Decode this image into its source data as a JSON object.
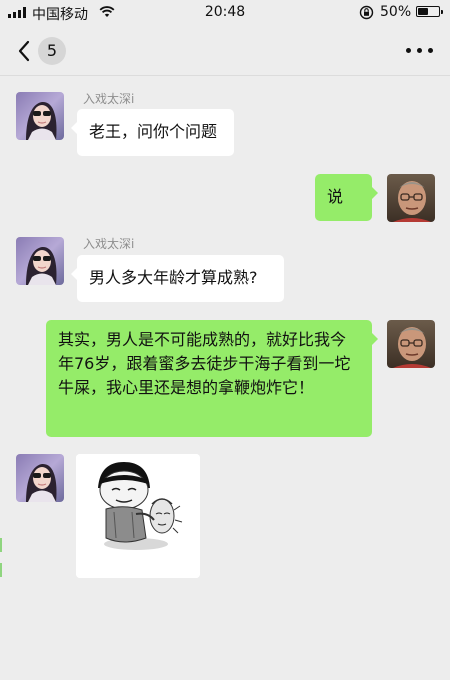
{
  "status_bar": {
    "carrier": "中国移动",
    "time": "20:48",
    "battery_percent": "50%",
    "battery_level": 0.5,
    "icons": [
      "signal-icon",
      "wifi-icon",
      "rotation-lock-icon",
      "battery-icon"
    ]
  },
  "nav": {
    "unread_count": "5",
    "back_icon": "chevron-left-icon",
    "more_icon": "more-icon"
  },
  "contact": {
    "name": "入戏太深i"
  },
  "messages": [
    {
      "side": "in",
      "sender": "入戏太深i",
      "text": "老王，问你个问题"
    },
    {
      "side": "out",
      "text": "说"
    },
    {
      "side": "in",
      "sender": "入戏太深i",
      "text": "男人多大年龄才算成熟?"
    },
    {
      "side": "out",
      "text": "其实，男人是不可能成熟的，就好比我今年76岁，跟着蜜多去徒步干海子看到一坨牛屎，我心里还是想的拿鞭炮炸它！"
    },
    {
      "side": "in",
      "type": "sticker",
      "sticker_icon": "meme-sticker-image"
    }
  ],
  "colors": {
    "background": "#ededed",
    "incoming_bubble": "#ffffff",
    "outgoing_bubble": "#95ec69",
    "name_text": "#8e8e8e"
  }
}
